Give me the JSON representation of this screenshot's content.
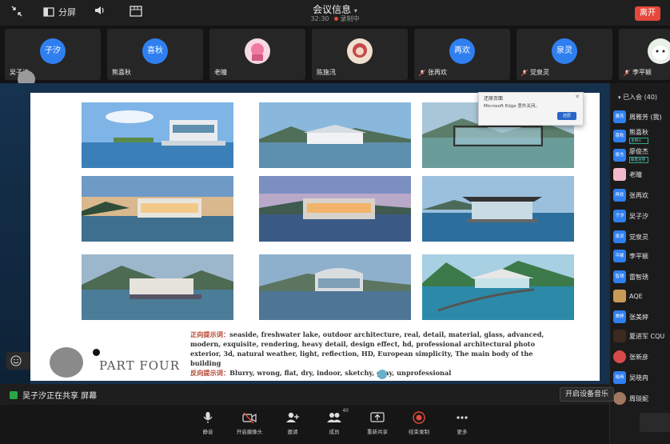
{
  "topbar": {
    "minimize_label": "",
    "layout_label": "分屏",
    "meeting_title": "会议信息",
    "meeting_time": "32:30",
    "recording_label": "录制中",
    "leave_label": "离开"
  },
  "participants_strip": [
    {
      "name": "吴子汐",
      "avatar": "子汐",
      "color": "#2f7ff0"
    },
    {
      "name": "熊喜秋",
      "avatar": "喜秋",
      "color": "#2f7ff0"
    },
    {
      "name": "老瞳",
      "avatar": "",
      "color": "#f2c4d0"
    },
    {
      "name": "陈施汛",
      "avatar": "",
      "color": "#e8d0c0"
    },
    {
      "name": "张再欢",
      "avatar": "再欢",
      "color": "#2f7ff0"
    },
    {
      "name": "党泉灵",
      "avatar": "泉灵",
      "color": "#2f7ff0"
    },
    {
      "name": "李平颖",
      "avatar": "",
      "color": "#9ad0a0"
    }
  ],
  "slide": {
    "positive_label": "正向提示词：",
    "positive_text": "seaside, freshwater lake, outdoor architecture, real, detail, material, glass, advanced, modern, exquisite, rendering, heavy detail, design effect, hd, professional architectural photo exterior, 3d, natural weather, light, reflection, HD, European simplicity, The main body of the building",
    "negative_label": "反向提示词：",
    "negative_text": "Blurry, wrong, flat, dry, indoor, sketchy, gray, unprofessional",
    "part_label": "PART FOUR"
  },
  "popup": {
    "title": "还原页面",
    "message": "Microsoft Edge 意外关闭。",
    "button": "还原"
  },
  "participant_list": {
    "header": "已入会 (40)",
    "items": [
      {
        "avatar": "雅芳",
        "name": "周雅芳 (我)",
        "tag": ""
      },
      {
        "avatar": "喜秋",
        "name": "熊喜秋",
        "tag": "主持人"
      },
      {
        "avatar": "俊杰",
        "name": "廖俊杰",
        "tag": "联席主持"
      },
      {
        "avatar": "",
        "name": "老瞳",
        "tag": ""
      },
      {
        "avatar": "再欢",
        "name": "张再欢",
        "tag": ""
      },
      {
        "avatar": "子汐",
        "name": "吴子汐",
        "tag": ""
      },
      {
        "avatar": "泉灵",
        "name": "党泉灵",
        "tag": ""
      },
      {
        "avatar": "平颖",
        "name": "李平颖",
        "tag": ""
      },
      {
        "avatar": "智琇",
        "name": "雷智琇",
        "tag": ""
      },
      {
        "avatar": "",
        "name": "AQE",
        "tag": ""
      },
      {
        "avatar": "美婷",
        "name": "张美婷",
        "tag": ""
      },
      {
        "avatar": "",
        "name": "夏进军 CQU",
        "tag": ""
      },
      {
        "avatar": "",
        "name": "张新彦",
        "tag": ""
      },
      {
        "avatar": "晓冉",
        "name": "吴晓冉",
        "tag": ""
      },
      {
        "avatar": "",
        "name": "周琰妮",
        "tag": ""
      }
    ]
  },
  "sharebar": {
    "status": "吴子汐正在共享 屏幕",
    "audio_button": "开启设备音乐"
  },
  "toolbar": {
    "mute": "静音",
    "camera": "开启摄像头",
    "invite": "邀请",
    "members": "成员",
    "members_count": "40",
    "reshare": "重新共享",
    "record": "结束录制",
    "more": "更多"
  },
  "colors": {
    "accent": "#2f7ff0",
    "leave": "#e5483a",
    "record": "#e34b3b",
    "share_green": "#27a745"
  }
}
